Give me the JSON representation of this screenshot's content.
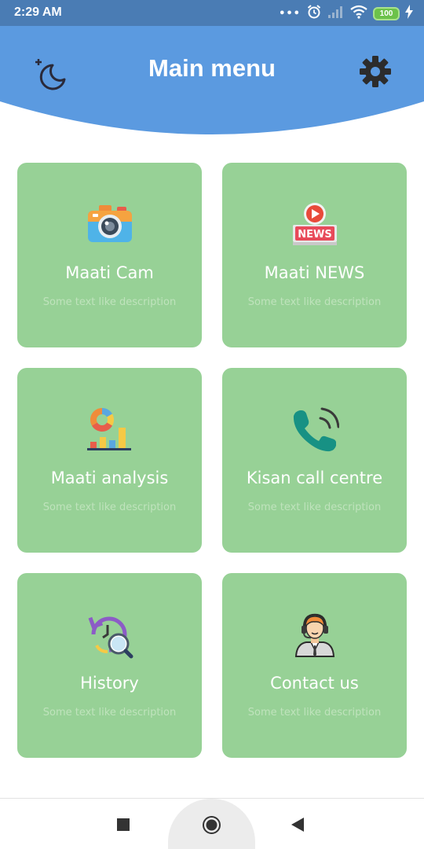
{
  "status_bar": {
    "time": "2:29 AM",
    "dots": "•••",
    "battery": "100",
    "icons": [
      "alarm-icon",
      "signal-icon",
      "wifi-icon",
      "battery-icon",
      "charging-icon"
    ]
  },
  "header": {
    "title": "Main menu",
    "background_color": "#5b9ae0",
    "icons": {
      "left": "moon-icon",
      "right": "gear-icon"
    }
  },
  "cards": [
    {
      "id": "maati-cam",
      "title": "Maati Cam",
      "description": "Some text like description",
      "icon": "camera-icon"
    },
    {
      "id": "maati-news",
      "title": "Maati NEWS",
      "description": "Some text like description",
      "icon": "news-icon",
      "icon_text": "NEWS"
    },
    {
      "id": "maati-analysis",
      "title": "Maati analysis",
      "description": "Some text like description",
      "icon": "analysis-chart-icon"
    },
    {
      "id": "kisan-call-centre",
      "title": "Kisan call centre",
      "description": "Some text like description",
      "icon": "phone-call-icon"
    },
    {
      "id": "history",
      "title": "History",
      "description": "Some text like description",
      "icon": "history-icon"
    },
    {
      "id": "contact-us",
      "title": "Contact us",
      "description": "Some text like description",
      "icon": "support-agent-icon"
    }
  ],
  "colors": {
    "card": "#97d196",
    "status_bar": "#4a7cb4"
  },
  "nav_bar": {
    "buttons": [
      "recents-square-icon",
      "home-circle-icon",
      "back-triangle-icon"
    ]
  }
}
